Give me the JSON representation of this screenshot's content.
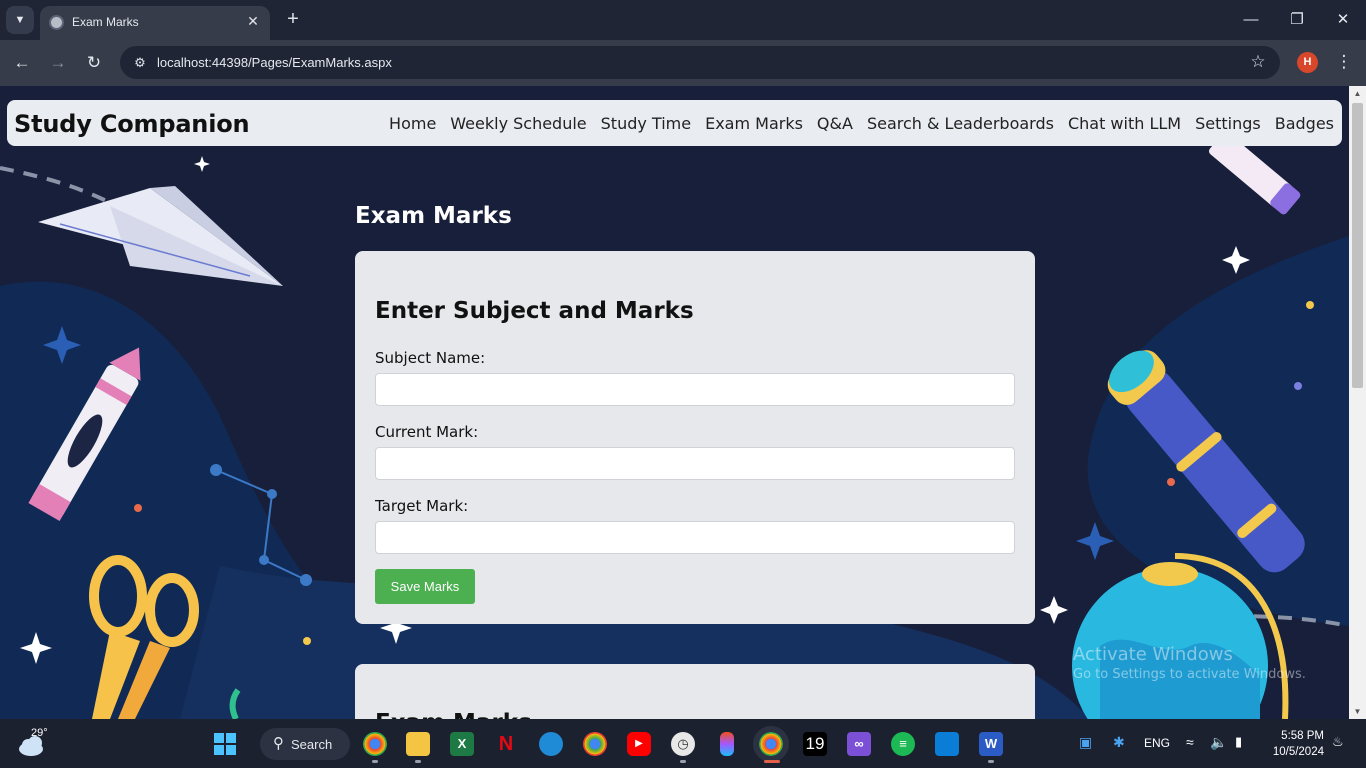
{
  "browser": {
    "tab_title": "Exam Marks",
    "url": "localhost:44398/Pages/ExamMarks.aspx",
    "profile_initial": "H"
  },
  "site": {
    "brand": "Study Companion",
    "nav": [
      "Home",
      "Weekly Schedule",
      "Study Time",
      "Exam Marks",
      "Q&A",
      "Search & Leaderboards",
      "Chat with LLM",
      "Settings",
      "Badges"
    ]
  },
  "page": {
    "heading": "Exam Marks",
    "form": {
      "title": "Enter Subject and Marks",
      "subject_label": "Subject Name:",
      "subject_value": "",
      "current_label": "Current Mark:",
      "current_value": "",
      "target_label": "Target Mark:",
      "target_value": "",
      "save_label": "Save Marks"
    },
    "second_card_title": "Exam Marks"
  },
  "watermark": {
    "line1": "Activate Windows",
    "line2": "Go to Settings to activate Windows."
  },
  "taskbar": {
    "temperature": "29°",
    "search_label": "Search",
    "calendar_day": "19",
    "language": "ENG",
    "time": "5:58 PM",
    "date": "10/5/2024"
  }
}
